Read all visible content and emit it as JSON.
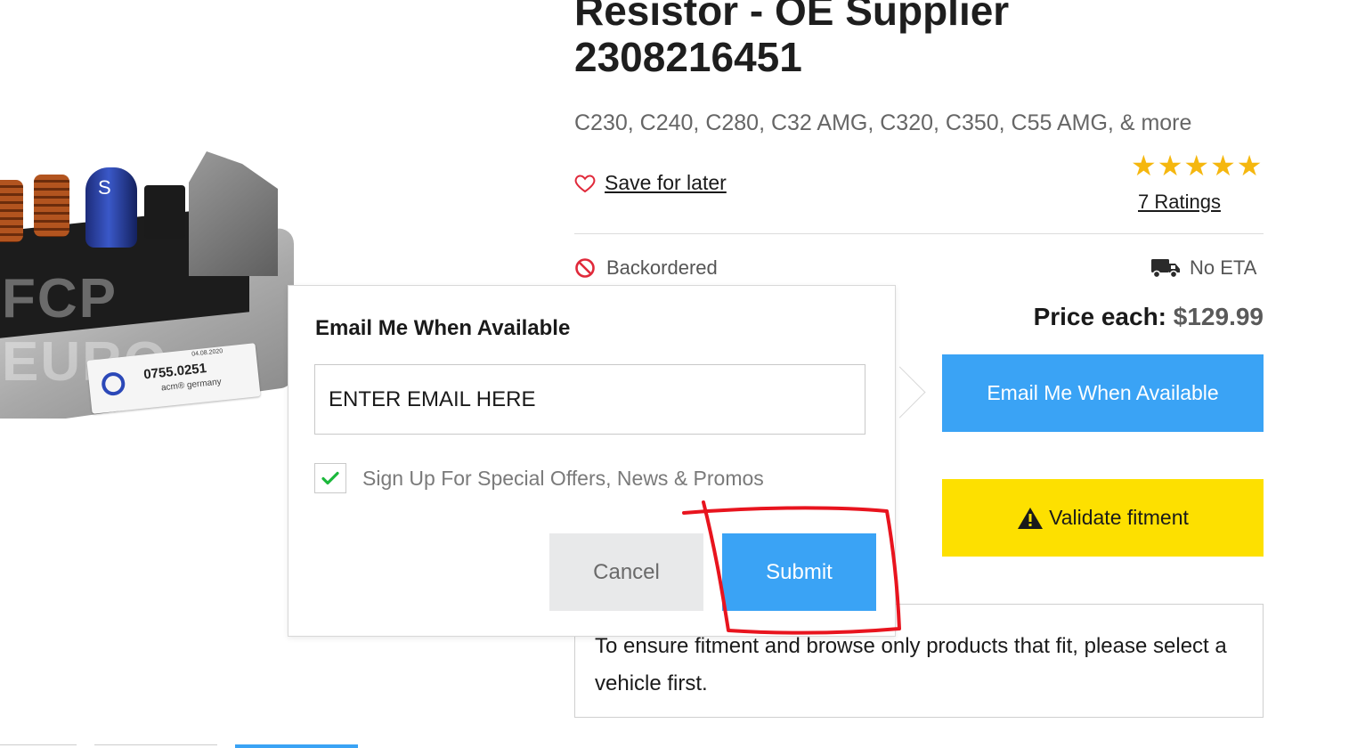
{
  "product": {
    "title_line1": "Resistor - OE Supplier",
    "title_line2": "2308216451",
    "models": "C230, C240, C280, C32 AMG, C320, C350, C55 AMG, & more",
    "save_label": "Save for later",
    "rating_stars": 5,
    "ratings_label": "7 Ratings",
    "stock_status": "Backordered",
    "eta_label": "No ETA",
    "price_label": "Price each:",
    "price_value": "$129.99",
    "email_button": "Email Me When Available",
    "validate_button": "Validate fitment",
    "fitment_message": "To ensure fitment and browse only products that fit, please select a vehicle first."
  },
  "image": {
    "watermark": "FCP EURO",
    "sticker_code": "0755.0251",
    "sticker_brand": "acm® germany",
    "sticker_date": "04.08.2020"
  },
  "popover": {
    "title": "Email Me When Available",
    "email_placeholder": "ENTER EMAIL HERE",
    "signup_label": "Sign Up For Special Offers, News & Promos",
    "signup_checked": true,
    "cancel_label": "Cancel",
    "submit_label": "Submit"
  },
  "colors": {
    "primary_blue": "#3aa3f5",
    "validate_yellow": "#fde000",
    "star_gold": "#f5b70f",
    "heart_red": "#e0293a",
    "check_green": "#1cb83c",
    "annotation_red": "#e8141e"
  },
  "icons": {
    "save": "heart-icon",
    "stock": "ban-icon",
    "eta": "truck-icon",
    "validate": "warning-icon",
    "checkbox": "check-icon"
  }
}
